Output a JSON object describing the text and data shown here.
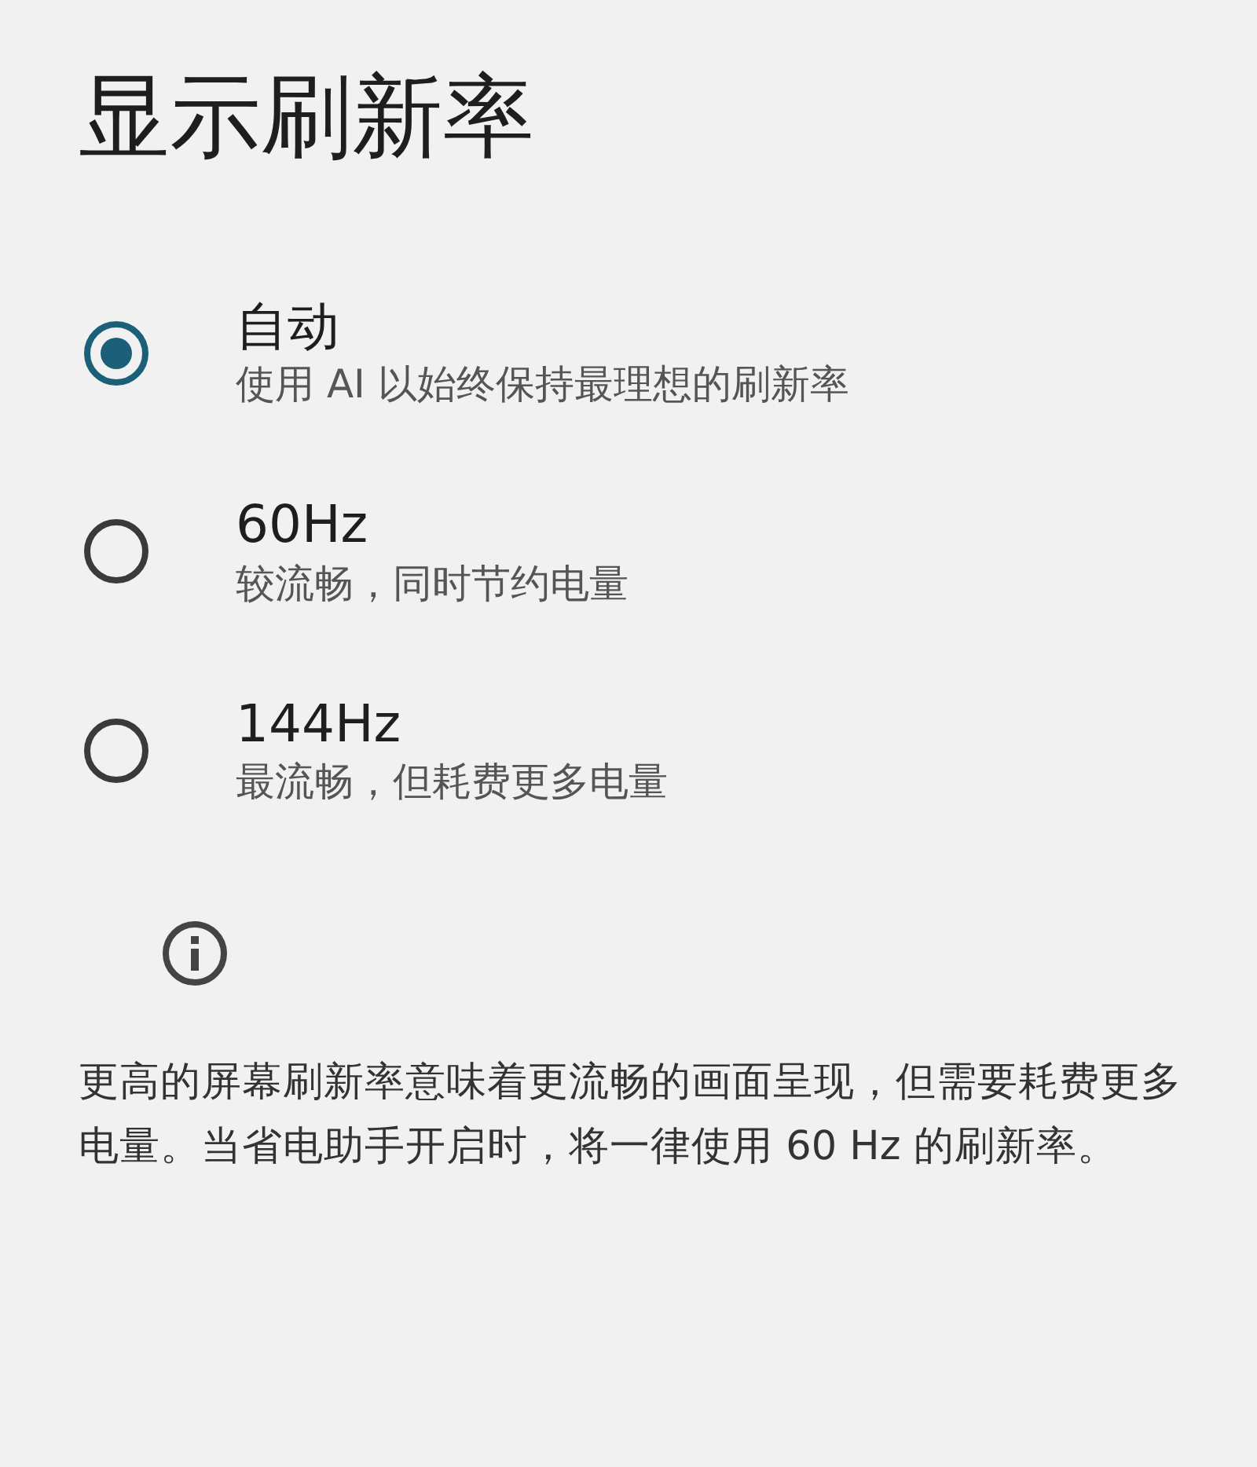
{
  "title": "显示刷新率",
  "options": [
    {
      "label": "自动",
      "description": "使用 AI 以始终保持最理想的刷新率",
      "selected": true
    },
    {
      "label": "60Hz",
      "description": "较流畅，同时节约电量",
      "selected": false
    },
    {
      "label": "144Hz",
      "description": "最流畅，但耗费更多电量",
      "selected": false
    }
  ],
  "info": "更高的屏幕刷新率意味着更流畅的画面呈现，但需要耗费更多电量。当省电助手开启时，将一律使用 60 Hz 的刷新率。"
}
